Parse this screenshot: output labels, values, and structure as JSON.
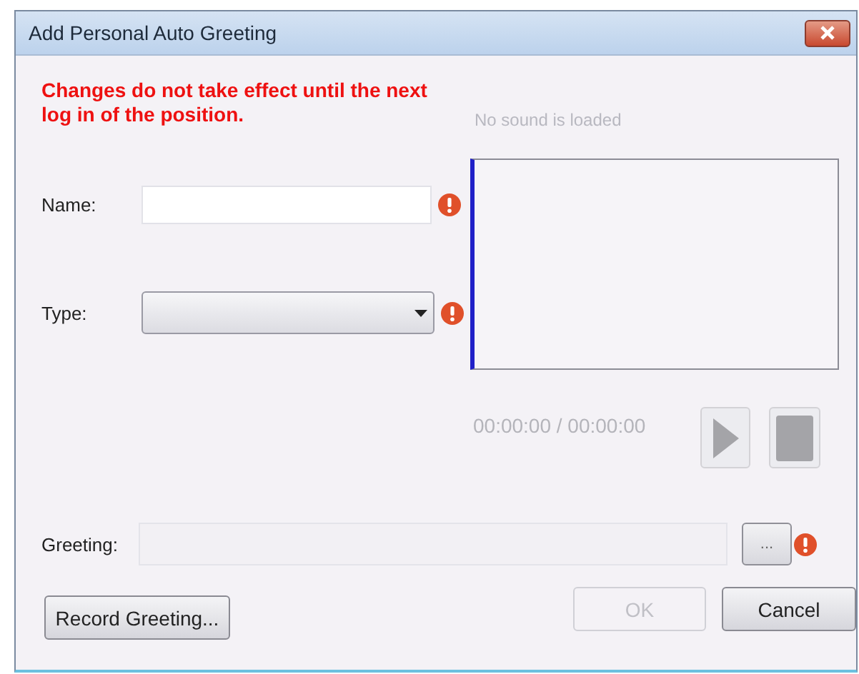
{
  "window": {
    "title": "Add Personal Auto Greeting"
  },
  "warning": "Changes do not take effect until the next log in of the position.",
  "sound_status": "No sound is loaded",
  "fields": [
    {
      "kind": "text",
      "label": "Name:",
      "error": true
    },
    {
      "kind": "combo",
      "label": "Type:",
      "error": true
    }
  ],
  "player": {
    "time": "00:00:00 / 00:00:00",
    "play_disabled": true,
    "stop_disabled": true
  },
  "greeting": {
    "label": "Greeting:",
    "browse_label": "...",
    "error": true
  },
  "buttons": [
    {
      "kind": "record",
      "label": "Record Greeting...",
      "disabled": false
    },
    {
      "kind": "ok",
      "label": "OK",
      "disabled": true
    },
    {
      "kind": "cancel",
      "label": "Cancel",
      "disabled": false
    }
  ]
}
